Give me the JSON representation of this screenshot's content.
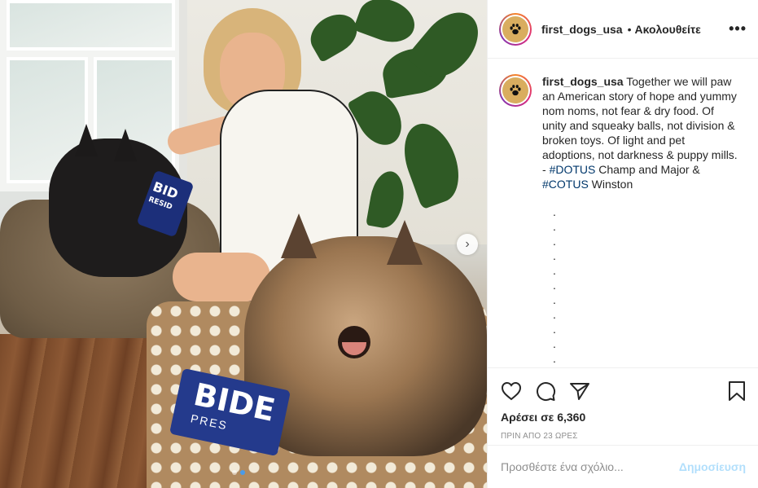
{
  "post": {
    "username": "first_dogs_usa",
    "separator": "•",
    "follow_label": "Ακολουθείτε",
    "more_label": "•••",
    "caption": {
      "username": "first_dogs_usa",
      "text_1": " Together we will paw an American story of hope and yummy nom noms, not fear & dry food. Of unity and squeaky balls, not division & broken toys. Of light and pet adoptions, not darkness & puppy mills. - ",
      "hashtag_1": "#DOTUS",
      "text_2": " Champ and Major & ",
      "hashtag_2": "#COTUS",
      "text_3": " Winston"
    },
    "dot_lines": [
      ".",
      ".",
      ".",
      ".",
      ".",
      ".",
      ".",
      ".",
      ".",
      ".",
      "."
    ],
    "likes": "Αρέσει σε 6,360",
    "timestamp": "ΠΡΙΝ ΑΠΟ 23 ΩΡΕΣ"
  },
  "photo": {
    "bandana_small_text": "BID",
    "bandana_small_sub": "RESID",
    "bandana_large_text": "BIDE",
    "bandana_large_sub": "PRES",
    "next_arrow": "›",
    "carousel": {
      "count": 2,
      "active": 1
    }
  },
  "comment": {
    "placeholder": "Προσθέστε ένα σχόλιο...",
    "post_label": "Δημοσίευση"
  },
  "icons": {
    "avatar": "paw-icon",
    "like": "heart-icon",
    "comment": "comment-icon",
    "share": "share-icon",
    "save": "bookmark-icon"
  },
  "colors": {
    "link": "#00376b",
    "post_button_disabled": "#b2dffc",
    "muted": "#8e8e8e"
  }
}
